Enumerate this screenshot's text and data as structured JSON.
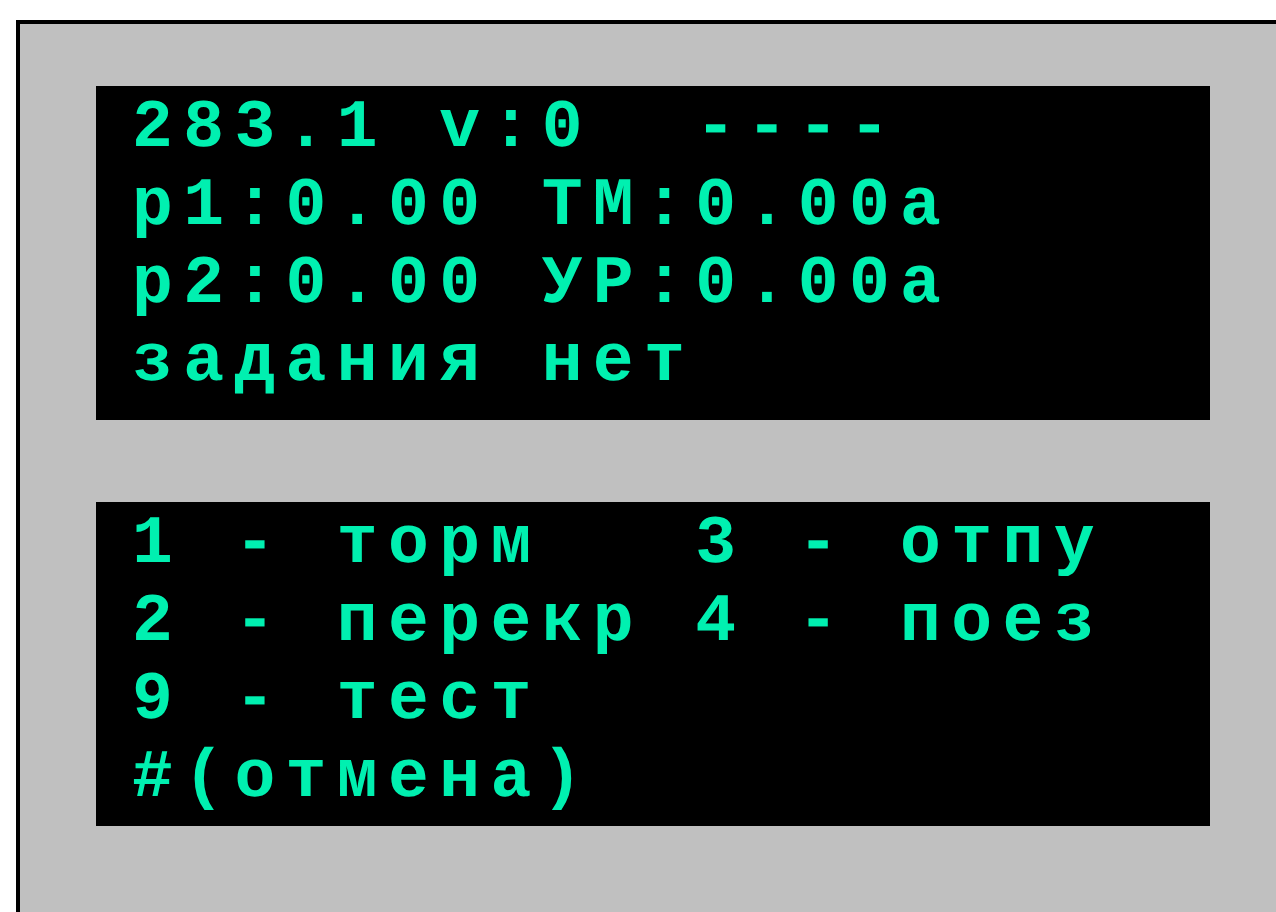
{
  "panels": [
    {
      "lines": [
        "283.1 v:0  ----",
        "p1:0.00 ТМ:0.00a",
        "p2:0.00 УР:0.00a",
        "задания нет"
      ]
    },
    {
      "lines": [
        "1 - торм   3 - отпу",
        "2 - перекр 4 - поез",
        "9 - тест",
        "#(отмена)"
      ]
    }
  ]
}
